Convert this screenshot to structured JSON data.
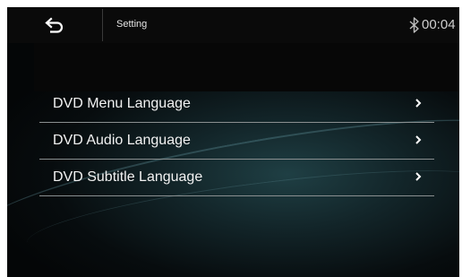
{
  "header": {
    "title": "Setting",
    "time": "00:04",
    "back_icon": "back-arrow-icon",
    "bluetooth_icon": "bluetooth-icon"
  },
  "menu": {
    "items": [
      {
        "label": "DVD Menu Language",
        "icon": "chevron-right-icon"
      },
      {
        "label": "DVD Audio Language",
        "icon": "chevron-right-icon"
      },
      {
        "label": "DVD Subtitle Language",
        "icon": "chevron-right-icon"
      }
    ]
  },
  "colors": {
    "background": "#0b1517",
    "text": "#f2f2f2",
    "divider": "#8a8f90"
  }
}
